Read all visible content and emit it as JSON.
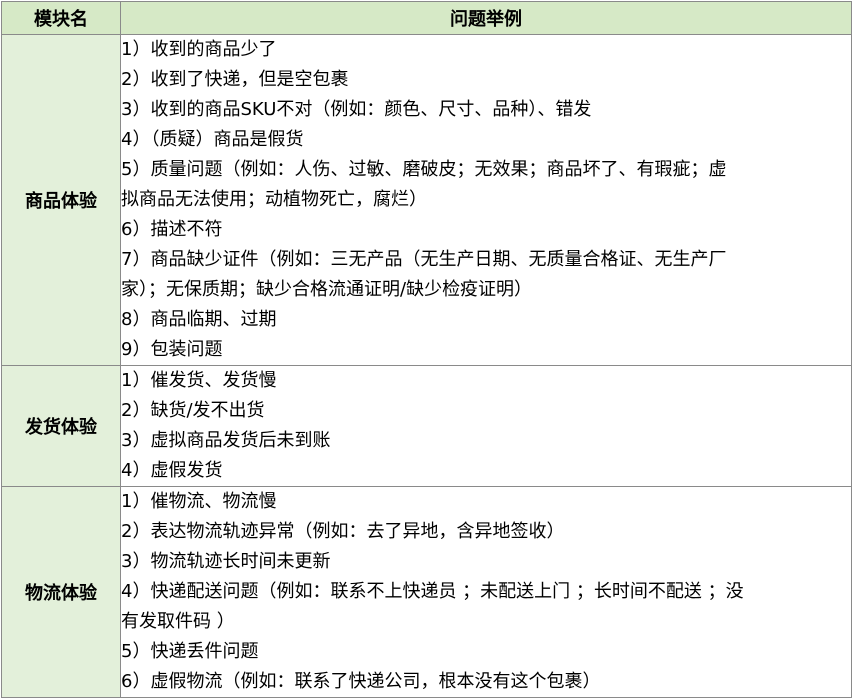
{
  "table": {
    "headers": {
      "module": "模块名",
      "issues": "问题举例"
    },
    "sections": [
      {
        "module": "商品体验",
        "lines": [
          "1）收到的商品少了",
          "2）收到了快递，但是空包裹",
          "3）收到的商品SKU不对（例如：颜色、尺寸、品种）、错发",
          "4）（质疑）商品是假货",
          "5）质量问题（例如：人伤、过敏、磨破皮；无效果；商品坏了、有瑕疵；虚",
          "拟商品无法使用；动植物死亡，腐烂）",
          "6）描述不符",
          "7）商品缺少证件（例如：三无产品（无生产日期、无质量合格证、无生产厂",
          "家）；无保质期；缺少合格流通证明/缺少检疫证明）",
          "8）商品临期、过期",
          "9）包装问题"
        ]
      },
      {
        "module": "发货体验",
        "lines": [
          "1）催发货、发货慢",
          "2）缺货/发不出货",
          "3）虚拟商品发货后未到账",
          "4）虚假发货"
        ]
      },
      {
        "module": "物流体验",
        "lines": [
          "1）催物流、物流慢",
          "2）表达物流轨迹异常（例如：去了异地，含异地签收）",
          "3）物流轨迹长时间未更新",
          "4）快递配送问题（例如：联系不上快递员 ；未配送上门 ；长时间不配送 ；没",
          "有发取件码 ）",
          "5）快递丢件问题",
          "6）虚假物流（例如：联系了快递公司，根本没有这个包裹）"
        ]
      }
    ]
  }
}
